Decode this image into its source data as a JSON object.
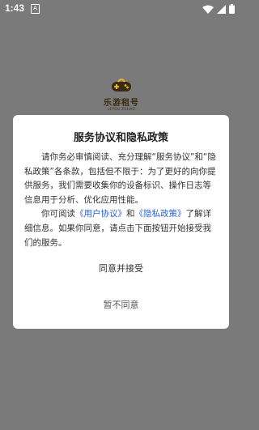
{
  "status_bar": {
    "time": "1:43",
    "notification_icon": "a-app-icon",
    "wifi_icon": "wifi-icon",
    "signal_icon": "signal-icon",
    "battery_icon": "battery-icon"
  },
  "logo": {
    "name": "乐游租号",
    "subtitle": "LEYOU ZUHAO"
  },
  "dialog": {
    "title": "服务协议和隐私政策",
    "para1": "请你务必审慎阅读、充分理解“服务协议”和“隐私政策”各条款，包括但不限于：为了更好的向你提供服务，我们需要收集你的设备标识、操作日志等信息用于分析、优化应用性能。",
    "para2_before": "你可阅读",
    "user_agreement_link": "《用户协议》",
    "para2_and": "和",
    "privacy_policy_link": "《隐私政策》",
    "para2_after": "了解详细信息。如果你同意，请点击下面按钮开始接受我们的服务。",
    "agree_button": "同意并接受",
    "disagree_button": "暂不同意"
  },
  "colors": {
    "overlay": "#7a7a7a",
    "link": "#2a63d6",
    "dialog_bg": "#ffffff"
  }
}
